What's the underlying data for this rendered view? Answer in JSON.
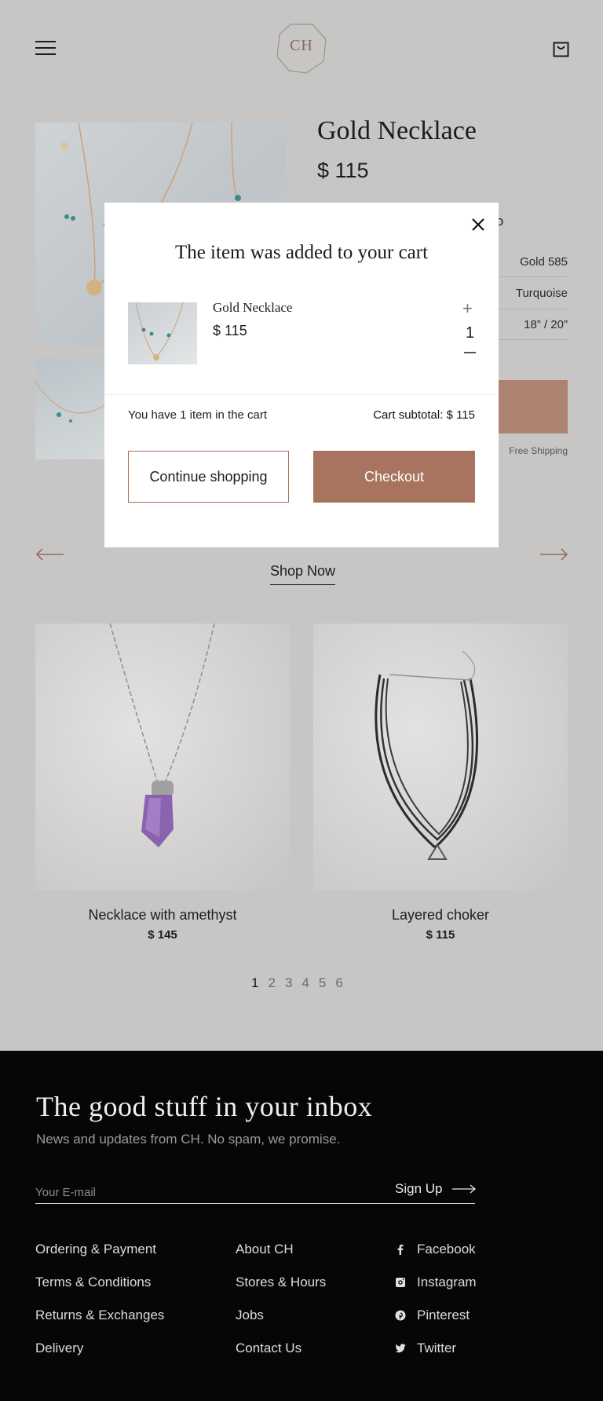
{
  "header": {
    "logo": "CH"
  },
  "product": {
    "title": "Gold Necklace",
    "price": "$ 115",
    "info_tab": "fo",
    "specs": [
      "Gold 585",
      "Turquoise",
      "18” / 20”"
    ],
    "free_shipping": "Free Shipping"
  },
  "modal": {
    "title": "The item was added to your cart",
    "item_name": "Gold Necklace",
    "item_price": "$ 115",
    "quantity": "1",
    "count_text": "You have 1 item in the cart",
    "subtotal": "Cart subtotal: $ 115",
    "continue_label": "Continue shopping",
    "checkout_label": "Checkout"
  },
  "shop_now": "Shop Now",
  "cards": [
    {
      "name": "Necklace with amethyst",
      "price": "$ 145"
    },
    {
      "name": "Layered choker",
      "price": "$ 115"
    }
  ],
  "pager": [
    "1",
    "2",
    "3",
    "4",
    "5",
    "6"
  ],
  "footer": {
    "title": "The good stuff in your inbox",
    "subtitle": "News and updates from CH. No spam, we promise.",
    "email_placeholder": "Your E-mail",
    "signup": "Sign Up",
    "col1": [
      "Ordering & Payment",
      "Terms & Conditions",
      "Returns & Exchanges",
      "Delivery"
    ],
    "col2": [
      "About CH",
      "Stores & Hours",
      "Jobs",
      "Contact Us"
    ],
    "col3": [
      "Facebook",
      "Instagram",
      "Pinterest",
      "Twitter"
    ]
  },
  "colors": {
    "accent": "#a87460",
    "footer_bg": "#060606",
    "overlay": "#c7c6c5"
  }
}
